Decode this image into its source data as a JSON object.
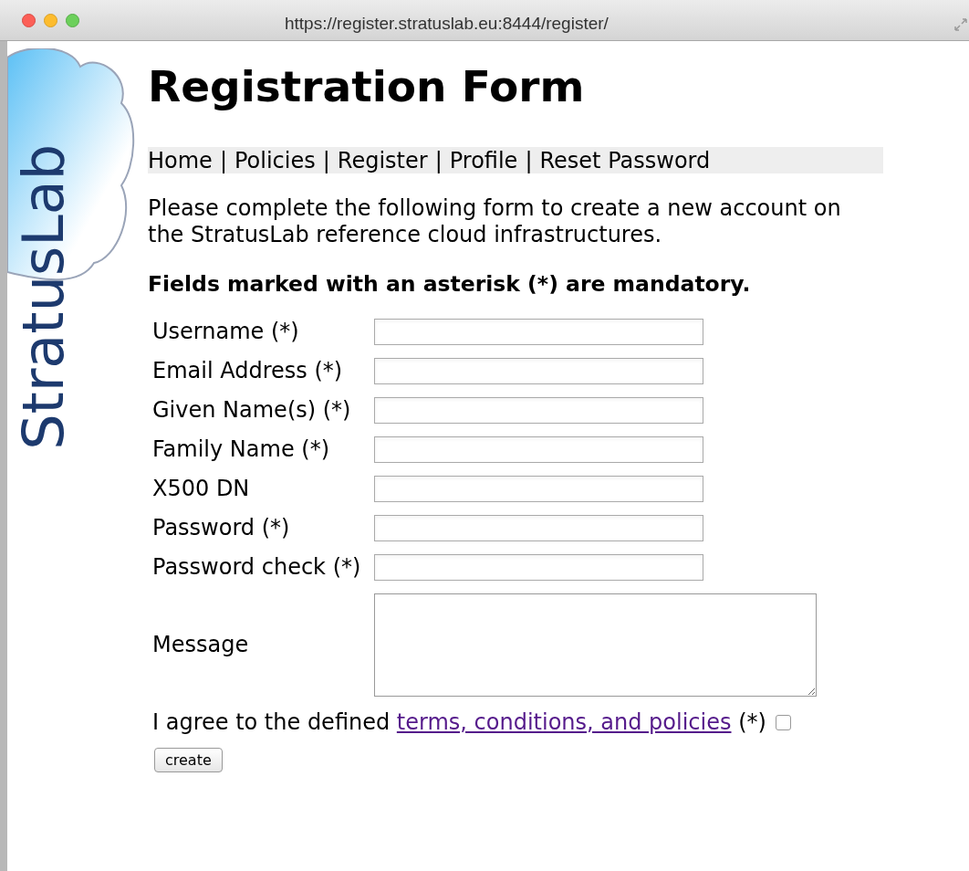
{
  "window": {
    "url": "https://register.stratuslab.eu:8444/register/"
  },
  "logo": {
    "text": "StratusLab"
  },
  "title": "Registration Form",
  "nav": [
    {
      "label": "Home",
      "separator": "|"
    },
    {
      "label": "Policies",
      "separator": "|"
    },
    {
      "label": "Register",
      "separator": "|"
    },
    {
      "label": "Profile",
      "separator": "|"
    },
    {
      "label": "Reset Password"
    }
  ],
  "intro": "Please complete the following form to create a new account on the StratusLab reference cloud infrastructures.",
  "mandatory_note": "Fields marked with an asterisk (*) are mandatory.",
  "fields": [
    {
      "kind": "text",
      "label": "Username (*)"
    },
    {
      "kind": "text",
      "label": "Email Address (*)"
    },
    {
      "kind": "text",
      "label": "Given Name(s) (*)"
    },
    {
      "kind": "text",
      "label": "Family Name (*)"
    },
    {
      "kind": "text",
      "label": "X500 DN"
    },
    {
      "kind": "password",
      "label": "Password (*)"
    },
    {
      "kind": "password",
      "label": "Password check (*)"
    },
    {
      "kind": "textarea",
      "label": "Message"
    }
  ],
  "agree": {
    "before": "I agree to the defined ",
    "link": "terms, conditions, and policies",
    "after": " (*)",
    "checked": false
  },
  "submit": "create"
}
